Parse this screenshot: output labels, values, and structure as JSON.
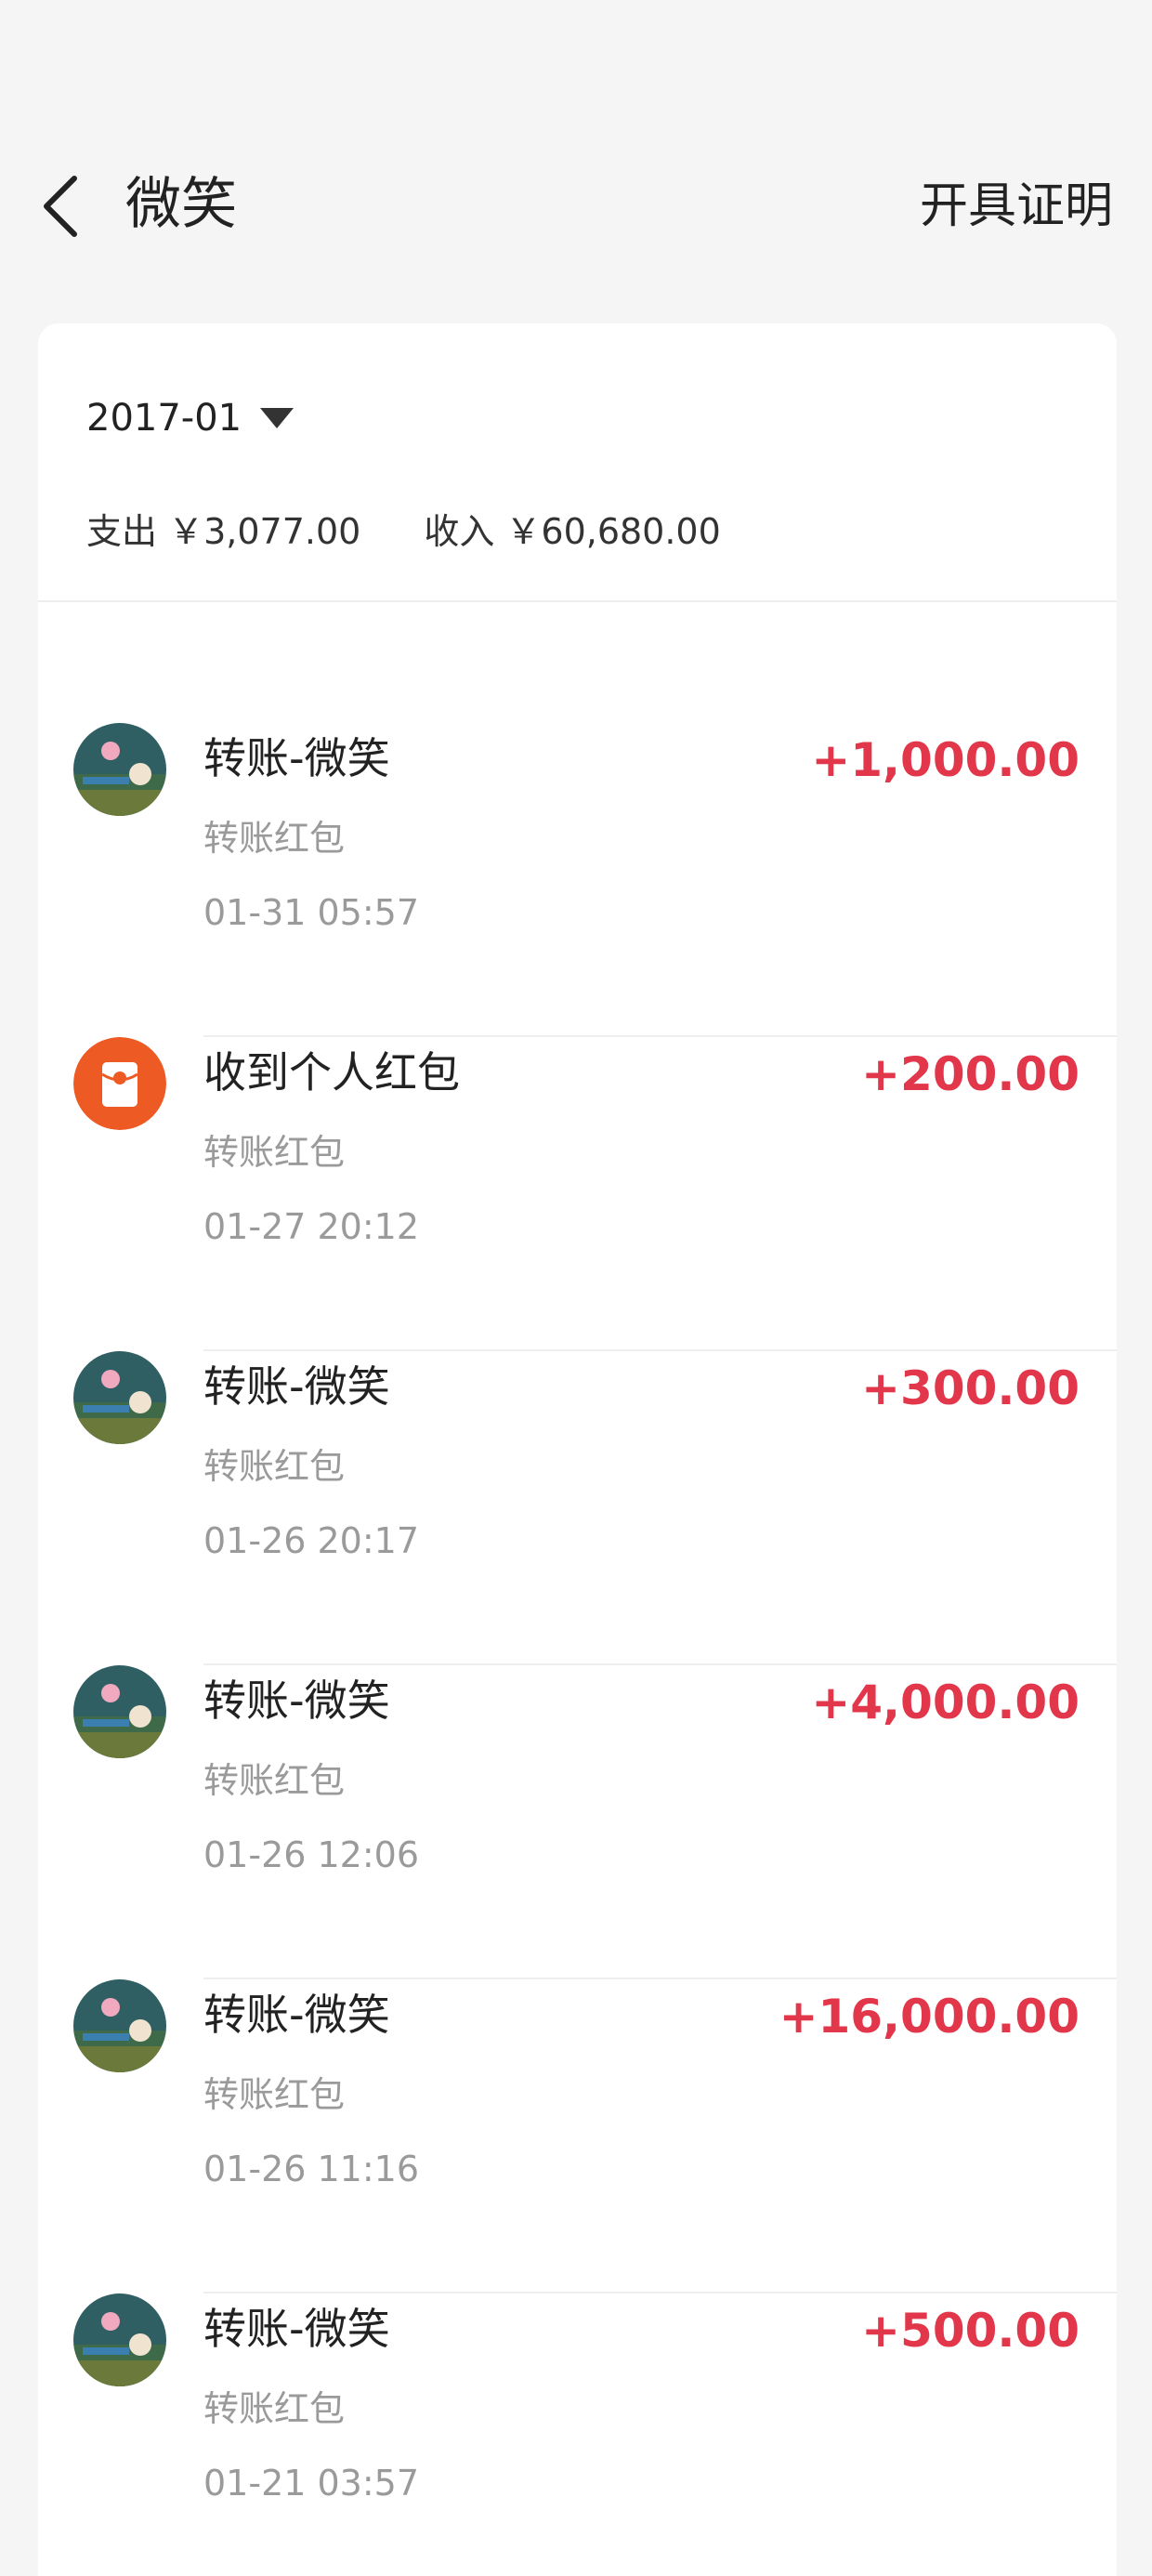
{
  "header": {
    "title": "微笑",
    "action_label": "开具证明"
  },
  "summary": {
    "month": "2017-01",
    "expense": "支出 ￥3,077.00",
    "income": "收入 ￥60,680.00"
  },
  "colors": {
    "amount_positive": "#e2364a",
    "redpacket_icon": "#ee5a24",
    "secondary_text": "#9a9a9a"
  },
  "transactions": [
    {
      "title": "转账-微笑",
      "type": "转账红包",
      "time": "01-31 05:57",
      "amount": "+1,000.00",
      "icon": "user-avatar"
    },
    {
      "title": "收到个人红包",
      "type": "转账红包",
      "time": "01-27 20:12",
      "amount": "+200.00",
      "icon": "red-packet-icon"
    },
    {
      "title": "转账-微笑",
      "type": "转账红包",
      "time": "01-26 20:17",
      "amount": "+300.00",
      "icon": "user-avatar"
    },
    {
      "title": "转账-微笑",
      "type": "转账红包",
      "time": "01-26 12:06",
      "amount": "+4,000.00",
      "icon": "user-avatar"
    },
    {
      "title": "转账-微笑",
      "type": "转账红包",
      "time": "01-26 11:16",
      "amount": "+16,000.00",
      "icon": "user-avatar"
    },
    {
      "title": "转账-微笑",
      "type": "转账红包",
      "time": "01-21 03:57",
      "amount": "+500.00",
      "icon": "user-avatar"
    }
  ]
}
